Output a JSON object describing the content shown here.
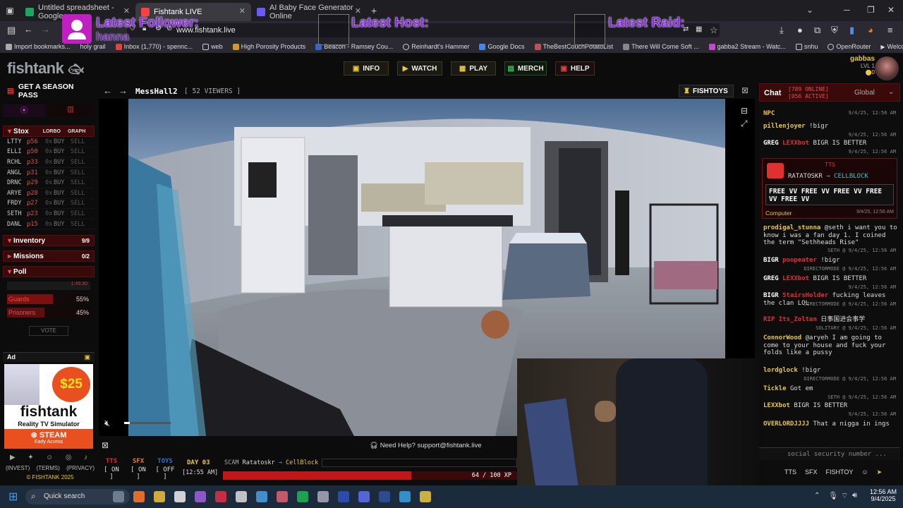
{
  "browser": {
    "tabs": [
      {
        "title": "Untitled spreadsheet - Google",
        "color": "#1fa463"
      },
      {
        "title": "Fishtank LIVE",
        "color": "#ff4040"
      },
      {
        "title": "AI Baby Face Generator Online",
        "color": "#6b5bff"
      }
    ],
    "url": "www.fishtank.live",
    "bookmarks": [
      "Import bookmarks...",
      "holy grail",
      "Inbox (1,770) - spennc...",
      "web",
      "High Porosity Products",
      "Beacon - Ramsey Cou...",
      "Reinhardt's Hammer",
      "Google Docs",
      "TheBestCouchPotatoList",
      "There Will Come Soft ...",
      "gabba2 Stream - Watc...",
      "snhu",
      "OpenRouter",
      "Welcome - freemedia..."
    ]
  },
  "overlay": {
    "follower": "Latest Follower:",
    "follower_name": "hanna",
    "host": "Latest Host:",
    "raid": "Latest Raid:"
  },
  "site": {
    "logo": "fishtank",
    "nav": [
      "INFO",
      "WATCH",
      "PLAY",
      "MERCH",
      "HELP"
    ],
    "user": {
      "name": "gabbas",
      "level": "LVL 1",
      "coins": "0"
    },
    "season_pass": "GET A SEASON PASS"
  },
  "stox": {
    "title": "Stox",
    "lorbo": "LORBO",
    "graph": "GRAPH",
    "rows": [
      {
        "name": "LTTY",
        "price": "56"
      },
      {
        "name": "ELLI",
        "price": "50"
      },
      {
        "name": "RCHL",
        "price": "33"
      },
      {
        "name": "ANGL",
        "price": "31"
      },
      {
        "name": "DRNC",
        "price": "29"
      },
      {
        "name": "ARYE",
        "price": "28"
      },
      {
        "name": "FRDY",
        "price": "27"
      },
      {
        "name": "SETH",
        "price": "23"
      },
      {
        "name": "DANL",
        "price": "15"
      }
    ],
    "owned": "0x",
    "buy": "BUY",
    "sell": "SELL"
  },
  "inventory": {
    "title": "Inventory",
    "count": "9/9"
  },
  "missions": {
    "title": "Missions",
    "count": "0/2"
  },
  "poll": {
    "title": "Poll",
    "timer": "1:49:30",
    "options": [
      {
        "label": "Guards",
        "pct": "55%",
        "value": 0.55
      },
      {
        "label": "Prisoners",
        "pct": "45%",
        "value": 0.45
      }
    ],
    "vote": "VOTE"
  },
  "ad": {
    "label": "Ad",
    "price": "$25",
    "brand": "fishtank",
    "sub": "Reality TV Simulator",
    "platform": "STEAM",
    "early": "Early Access"
  },
  "footer": {
    "links": [
      "INVEST",
      "TERMS",
      "PRIVACY"
    ],
    "copy": "© FISHTANK 2025"
  },
  "player": {
    "room": "MessHall2",
    "viewers": "[ 52 VIEWERS ]",
    "fishtoys": "FISHTOYS",
    "help": "Need Help? support@fishtank.live",
    "toggles": [
      {
        "label": "TTS",
        "state": "[ ON ]",
        "color": "#e03030"
      },
      {
        "label": "SFX",
        "state": "[ ON ]",
        "color": "#e08030"
      },
      {
        "label": "TOYS",
        "state": "[ OFF ]",
        "color": "#3070d0"
      }
    ],
    "day": "DAY 03",
    "time": "[12:55 AM]",
    "scam_label": "SCAM",
    "scam_from": "Ratatoskr",
    "scam_to": "CellBlock",
    "xp": "64 / 100 XP",
    "xp_value": 0.64
  },
  "chat": {
    "title": "Chat",
    "online": "[789 ONLINE]",
    "active": "[056 ACTIVE]",
    "room": "Global",
    "tts_banner": {
      "label": "TTS",
      "from": "RATATOSKR",
      "to": "CELLBLOCK",
      "message": "FREE VV FREE VV FREE VV FREE VV FREE VV",
      "room": "Computer",
      "time": "9/4/25, 12:56 AM"
    },
    "messages": [
      {
        "user": "NPC",
        "text": "",
        "meta": "9/4/25, 12:56 AM"
      },
      {
        "user": "pillenjoyer",
        "text": "!bigr",
        "meta": "9/4/25, 12:56 AM"
      },
      {
        "user": "GREG",
        "user2": "LEXXbot",
        "text": "BIGR IS BETTER",
        "meta": "9/4/25, 12:56 AM"
      },
      {
        "user": "prodigal_stunna",
        "text": "@seth i want you to know i was a fan day 1. I coined the term \"Sethheads Rise\"",
        "meta": "SETH @ 9/4/25, 12:56 AM"
      },
      {
        "user": "BIGR",
        "user2": "poopeater",
        "text": "!bigr",
        "meta": "DIRECTORMODE @ 9/4/25, 12:56 AM"
      },
      {
        "user": "GREG",
        "user2": "LEXXbot",
        "text": "BIGR IS BETTER",
        "meta": "9/4/25, 12:56 AM"
      },
      {
        "user": "BIGR",
        "user2": "StairsHolder",
        "text": "fucking leaves the clan LOL",
        "meta": "DIRECTORMODE @ 9/4/25, 12:56 AM"
      },
      {
        "user": "RIP",
        "user2": "Its_Zoltan",
        "text": "日事国进会事学",
        "meta": "SOLITARY @ 9/4/25, 12:56 AM"
      },
      {
        "user": "ConnorWood",
        "text": "@aryeh I am going to come to your house and fuck your folds like a pussy",
        "meta": ""
      },
      {
        "user": "lordglock",
        "text": "!bigr",
        "meta": "DIRECTORMODE @ 9/4/25, 12:56 AM"
      },
      {
        "user": "Tickle",
        "text": "Got em",
        "meta": "SETH @ 9/4/25, 12:56 AM"
      },
      {
        "user": "LEXXbot",
        "text": "BIGR IS BETTER",
        "meta": "9/4/25, 12:56 AM"
      },
      {
        "user": "OVERLORDJJJJ",
        "text": "That a nigga in ings",
        "meta": ""
      }
    ],
    "input_placeholder": "social security number ...",
    "buttons": [
      "TTS",
      "SFX",
      "FISHTOY"
    ]
  },
  "taskbar": {
    "search": "Quick search",
    "time": "12:56 AM",
    "date": "9/4/2025"
  }
}
